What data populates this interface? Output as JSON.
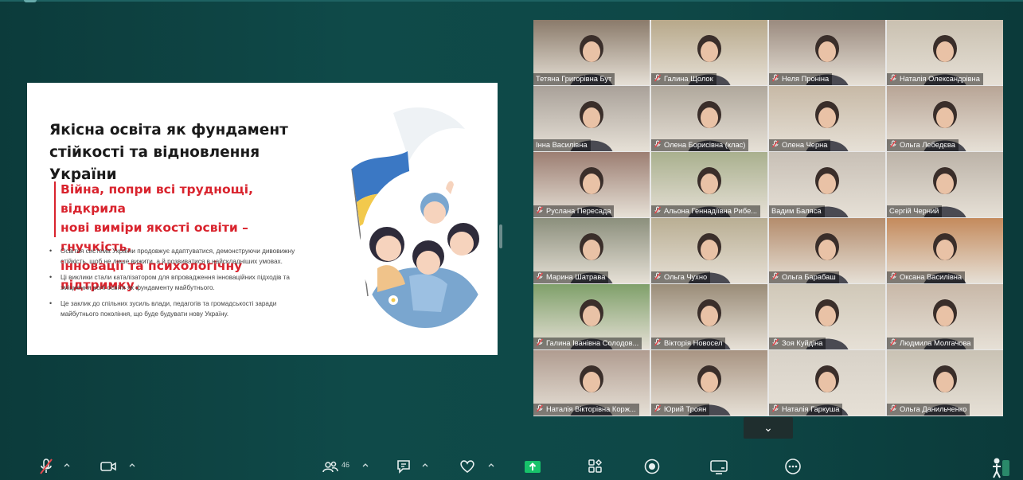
{
  "slide": {
    "title_line1": "Якісна освіта як фундамент",
    "title_line2": "стійкості та відновлення України",
    "quote_line1": "Війна, попри всі труднощі, відкрила",
    "quote_line2": "нові виміри якості освіти – гнучкість,",
    "quote_line3": "інновації та психологічну підтримку.",
    "bullets": [
      {
        "line1": "Освітня система України продовжує адаптуватися, демонструючи дивовижну",
        "line2": "стійкість, щоб не лише вижити, а й розвиватися в найскладніших умовах."
      },
      {
        "line1": "Ці виклики стали каталізатором для впровадження інноваційних підходів та",
        "line2": "зміцнення ролі освіти як фундаменту майбутнього."
      },
      {
        "line1": "Це заклик до спільних зусиль влади, педагогів та громадськості заради",
        "line2": "майбутнього покоління, що буде будувати нову Україну."
      }
    ],
    "bullet_glyph": "•"
  },
  "participants": [
    {
      "name": "Тетяна Григорівна Бут",
      "muted": false
    },
    {
      "name": "Галина Щолок",
      "muted": true
    },
    {
      "name": "Неля Проніна",
      "muted": true
    },
    {
      "name": "Наталія Олександрівна",
      "muted": true
    },
    {
      "name": "Інна Василівна",
      "muted": false
    },
    {
      "name": "Олена Борисівна (клас)",
      "muted": true
    },
    {
      "name": "Олена Черна",
      "muted": true
    },
    {
      "name": "Ольга Лебедєва",
      "muted": true
    },
    {
      "name": "Руслана Пересада",
      "muted": true
    },
    {
      "name": "Альона Геннадіївна Рибе...",
      "muted": true
    },
    {
      "name": "Вадим Баляса",
      "muted": false
    },
    {
      "name": "Сергій Черний",
      "muted": false
    },
    {
      "name": "Марина  Шатрава",
      "muted": true
    },
    {
      "name": "Ольга Чухно",
      "muted": true
    },
    {
      "name": "Ольга Барабаш",
      "muted": true
    },
    {
      "name": "Оксана Василівна",
      "muted": true
    },
    {
      "name": "Галина Іванівна Солодов...",
      "muted": true
    },
    {
      "name": "Вікторія Новосел",
      "muted": true
    },
    {
      "name": "Зоя Куйдіна",
      "muted": true
    },
    {
      "name": "Людмила Молгачова",
      "muted": true
    },
    {
      "name": "Наталія Вікторівна Корж...",
      "muted": true
    },
    {
      "name": "Юрий Троян",
      "muted": true
    },
    {
      "name": "Наталія Гаркуша",
      "muted": true
    },
    {
      "name": "Ольга Данильченко",
      "muted": true
    }
  ],
  "active_speaker": "Олена Черна",
  "collapse_glyph": "⌄",
  "toolbar": {
    "participants_count": "46",
    "icons": [
      "mic-muted-icon",
      "video-camera-icon",
      "participants-icon",
      "chat-icon",
      "reactions-icon",
      "share-screen-icon",
      "apps-icon",
      "record-icon",
      "whiteboard-icon",
      "more-icon"
    ],
    "share_color": "#17c26a"
  },
  "colors": {
    "background": "#0e4847",
    "quote_red": "#d9232d",
    "active_border": "#3fbf5f",
    "flag_blue": "#3b78c4",
    "flag_yellow": "#f2c94c"
  }
}
